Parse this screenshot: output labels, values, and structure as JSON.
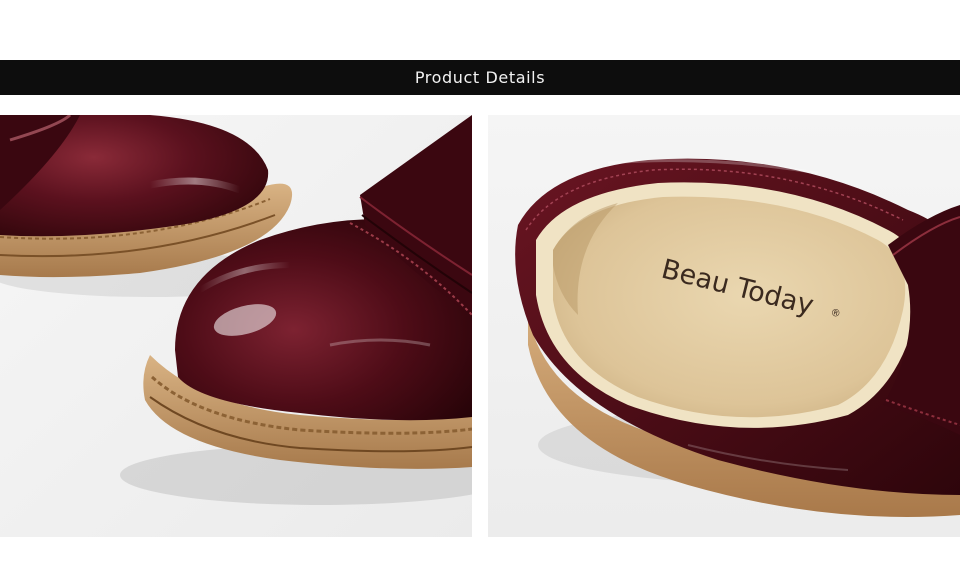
{
  "header": {
    "title": "Product Details"
  },
  "photos": {
    "left": {
      "subject": "shoe-toe-closeup"
    },
    "right": {
      "subject": "shoe-insole-closeup",
      "insole_brand": "Beau Today",
      "insole_mark": "®"
    }
  },
  "colors": {
    "banner": "#0d0d0d",
    "leather": "#5a0f1c",
    "sole": "#c49a6c",
    "insole": "#e2cfa6"
  }
}
